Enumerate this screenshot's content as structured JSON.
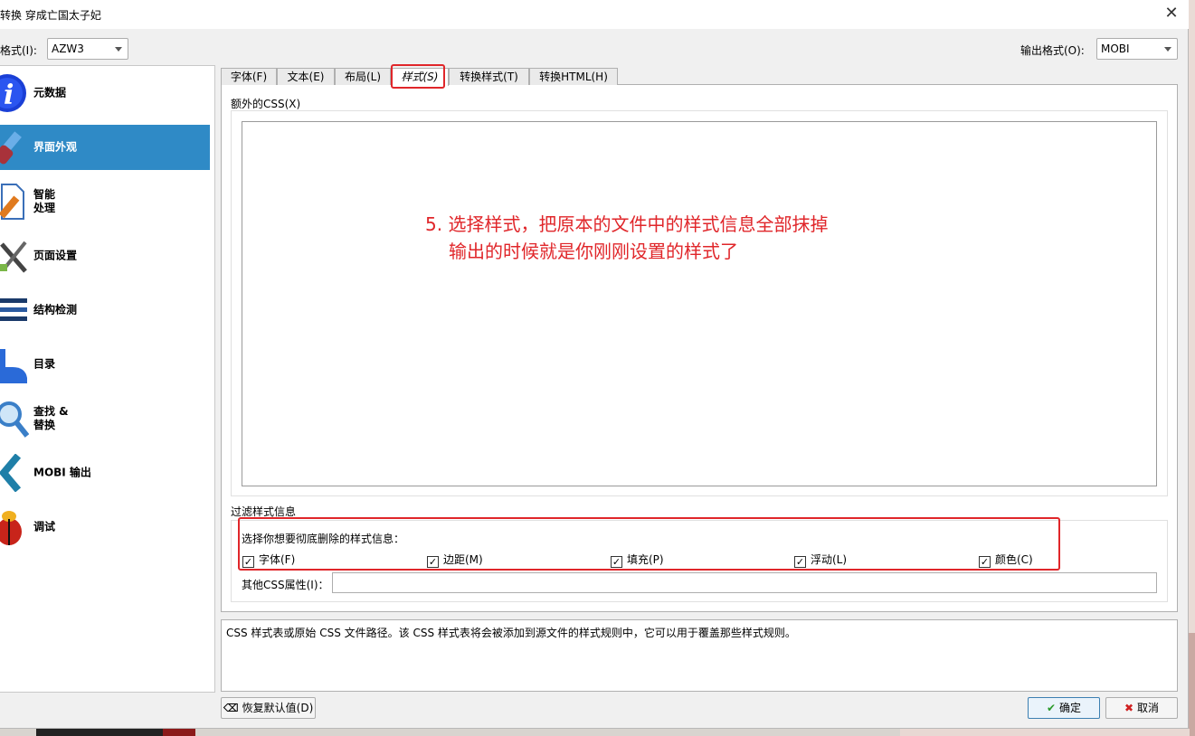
{
  "window": {
    "title": "转换 穿成亡国太子妃",
    "close_icon": "close-icon"
  },
  "input_format": {
    "label": "格式(I):",
    "value": "AZW3"
  },
  "output_format": {
    "label": "输出格式(O):",
    "value": "MOBI"
  },
  "sidebar": {
    "items": [
      {
        "label": "元数据",
        "icon": "info-icon"
      },
      {
        "label": "界面外观",
        "icon": "paintbrush-icon",
        "selected": true
      },
      {
        "label": "智能\n处理",
        "icon": "document-pen-icon"
      },
      {
        "label": "页面设置",
        "icon": "tools-icon"
      },
      {
        "label": "结构检测",
        "icon": "lines-icon"
      },
      {
        "label": "目录",
        "icon": "toc-icon"
      },
      {
        "label": "查找 &\n替换",
        "icon": "magnifier-icon"
      },
      {
        "label": "MOBI 输出",
        "icon": "chevron-left-icon"
      },
      {
        "label": "调试",
        "icon": "bug-icon"
      }
    ]
  },
  "tabs": [
    {
      "label": "字体(F)"
    },
    {
      "label": "文本(E)"
    },
    {
      "label": "布局(L)"
    },
    {
      "label": "样式(S)",
      "active": true
    },
    {
      "label": "转换样式(T)"
    },
    {
      "label": "转换HTML(H)"
    }
  ],
  "style_tab": {
    "extra_css_label": "额外的CSS(X)",
    "extra_css_value": "",
    "annotation_line1": "5. 选择样式，把原本的文件中的样式信息全部抹掉",
    "annotation_line2": "输出的时候就是你刚刚设置的样式了",
    "filter_title": "过滤样式信息",
    "filter_hint": "选择你想要彻底删除的样式信息：",
    "checkboxes": [
      {
        "label": "字体(F)",
        "checked": true
      },
      {
        "label": "边距(M)",
        "checked": true
      },
      {
        "label": "填充(P)",
        "checked": true
      },
      {
        "label": "浮动(L)",
        "checked": true
      },
      {
        "label": "颜色(C)",
        "checked": true
      }
    ],
    "other_css_label": "其他CSS属性(I)：",
    "other_css_value": ""
  },
  "help_text": "CSS 样式表或原始 CSS 文件路径。该 CSS 样式表将会被添加到源文件的样式规则中，它可以用于覆盖那些样式规则。",
  "buttons": {
    "restore_defaults": "恢复默认值(D)",
    "ok": "确定",
    "cancel": "取消"
  },
  "colors": {
    "selection": "#2f8ac6",
    "annotation": "#e0262a"
  }
}
